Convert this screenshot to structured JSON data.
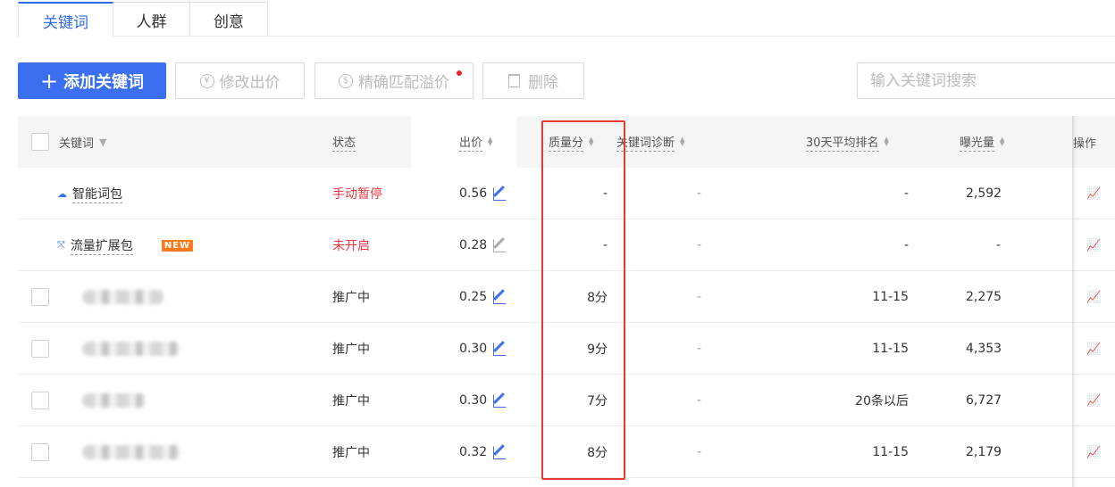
{
  "tabs": [
    {
      "label": "关键词",
      "active": true
    },
    {
      "label": "人群",
      "active": false
    },
    {
      "label": "创意",
      "active": false
    }
  ],
  "toolbar": {
    "add_label": "添加关键词",
    "modify_price_label": "修改出价",
    "exact_match_label": "精确匹配溢价",
    "delete_label": "删除",
    "search_placeholder": "输入关键词搜索"
  },
  "table": {
    "headers": {
      "keyword": "关键词",
      "status": "状态",
      "bid": "出价",
      "quality": "质量分",
      "diagnosis": "关键词诊断",
      "rank": "30天平均排名",
      "impressions": "曝光量",
      "actions": "操作"
    },
    "rows": [
      {
        "keyword": "智能词包",
        "status": "手动暂停",
        "bid": "0.56",
        "quality": "-",
        "diagnosis": "-",
        "rank": "-",
        "impressions": "2,592"
      },
      {
        "keyword": "流量扩展包",
        "badge": "NEW",
        "status": "未开启",
        "bid": "0.28",
        "quality": "-",
        "diagnosis": "-",
        "rank": "-",
        "impressions": "-"
      },
      {
        "keyword": "",
        "status": "推广中",
        "bid": "0.25",
        "quality": "8分",
        "diagnosis": "-",
        "rank": "11-15",
        "impressions": "2,275"
      },
      {
        "keyword": "",
        "status": "推广中",
        "bid": "0.30",
        "quality": "9分",
        "diagnosis": "-",
        "rank": "11-15",
        "impressions": "4,353"
      },
      {
        "keyword": "",
        "status": "推广中",
        "bid": "0.30",
        "quality": "7分",
        "diagnosis": "-",
        "rank": "20条以后",
        "impressions": "6,727"
      },
      {
        "keyword": "",
        "status": "推广中",
        "bid": "0.32",
        "quality": "8分",
        "diagnosis": "-",
        "rank": "11-15",
        "impressions": "2,179"
      }
    ]
  },
  "colors": {
    "primary": "#3c6ff0",
    "status_red": "#e8383d",
    "highlight": "#e43d30",
    "new_badge": "#ff7a1a"
  },
  "icons": {
    "add": "plus-icon",
    "modify_price": "yen-circle-icon",
    "exact_match": "dollar-circle-icon",
    "delete": "trash-icon",
    "smart_pack": "cloud-icon",
    "traffic_pack": "expand-icon",
    "row_action": "line-chart-icon"
  }
}
